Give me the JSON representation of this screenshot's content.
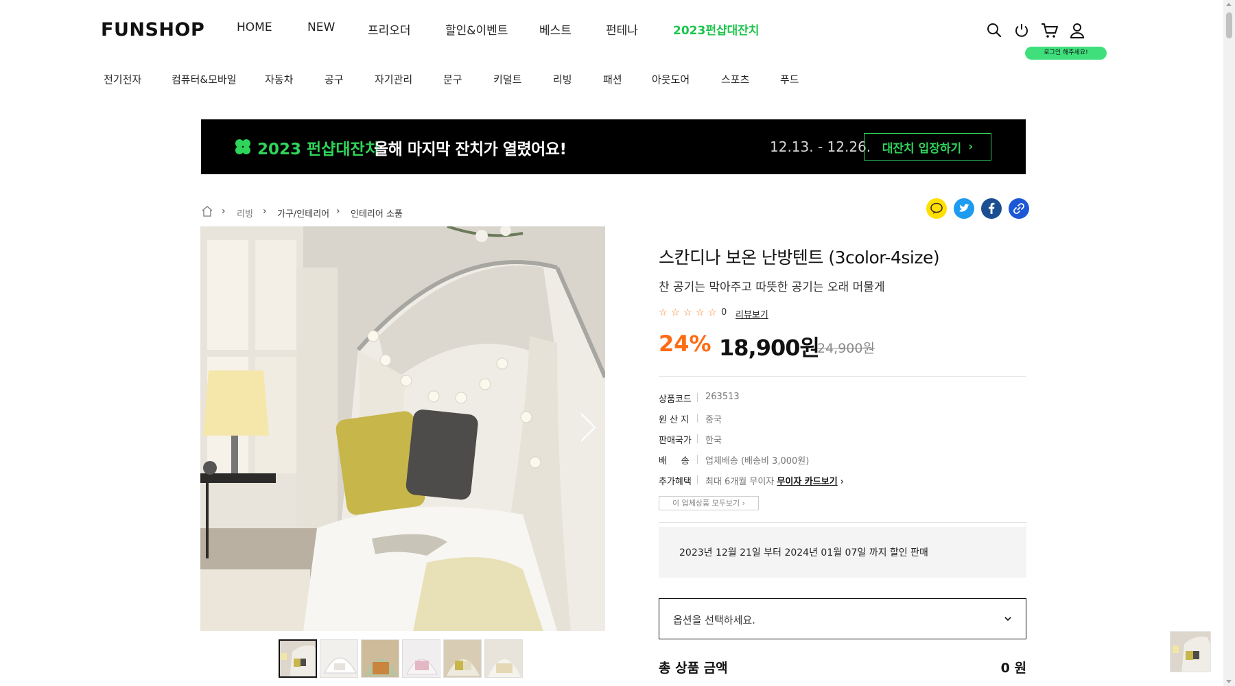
{
  "header": {
    "logo": "FUNSHOP",
    "nav": [
      "HOME",
      "NEW",
      "프리오더",
      "할인&이벤트",
      "베스트",
      "펀테나",
      "2023펀샵대잔치"
    ],
    "icons": [
      "search-icon",
      "power-icon",
      "cart-icon",
      "user-icon"
    ],
    "login_bubble": "로그인 해주세요!"
  },
  "categories": [
    "전기전자",
    "컴퓨터&모바일",
    "자동차",
    "공구",
    "자기관리",
    "문구",
    "키덜트",
    "리빙",
    "패션",
    "아웃도어",
    "스포츠",
    "푸드"
  ],
  "banner": {
    "title": "2023 펀샵대잔치",
    "message": "올해 마지막 잔치가 열렸어요!",
    "date": "12.13. - 12.26.",
    "button": "대잔치 입장하기"
  },
  "breadcrumb": [
    "리빙",
    "가구/인테리어",
    "인테리어 소품"
  ],
  "share": [
    "kakao-icon",
    "twitter-icon",
    "facebook-icon",
    "link-icon"
  ],
  "product": {
    "title": "스칸디나 보온 난방텐트 (3color-4size)",
    "subtitle": "찬 공기는 막아주고 따뜻한 공기는 오래 머물게",
    "rating": {
      "stars": 0,
      "count": "0",
      "review_link": "리뷰보기"
    },
    "discount": "24%",
    "price": "18,900원",
    "original_price": "24,900원",
    "specs": [
      {
        "label": "상품코드",
        "value": "263513"
      },
      {
        "label": "원 산 지",
        "value": "중국"
      },
      {
        "label": "판매국가",
        "value": "한국"
      },
      {
        "label": "배     송",
        "value": "업체배송 (배송비 3,000원)"
      },
      {
        "label": "추가혜택",
        "value": "최대 6개월 무이자",
        "link": "무이자 카드보기"
      }
    ],
    "seller_button": "이 업체상품 모두보기",
    "notice": "2023년 12월 21일 부터 2024년 01월 07일 까지 할인 판매",
    "option_placeholder": "옵션을 선택하세요.",
    "total_label": "총 상품 금액",
    "total_value": "0 원"
  },
  "colors": {
    "accent_green": "#2fd45a",
    "discount_orange": "#ff6b14",
    "kakao": "#ffe000",
    "twitter": "#1d9bf0",
    "facebook": "#1b4f91",
    "link": "#1c57d6"
  }
}
